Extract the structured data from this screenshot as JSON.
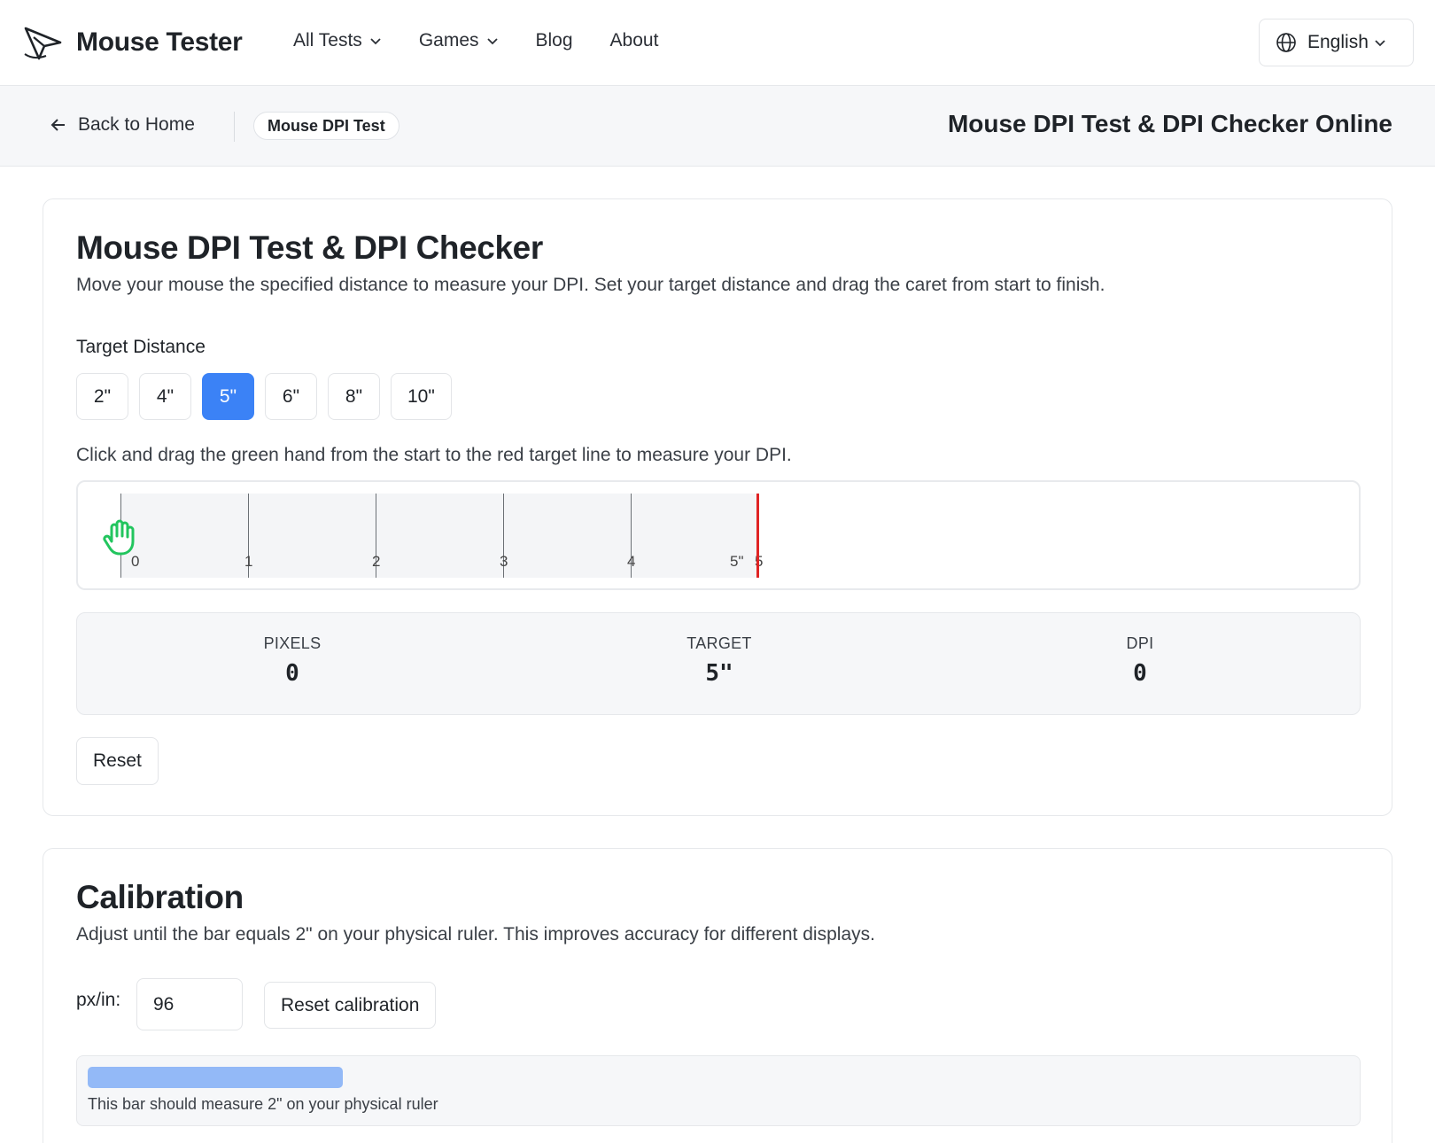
{
  "header": {
    "brand": "Mouse Tester",
    "nav": [
      {
        "label": "All Tests"
      },
      {
        "label": "Games"
      },
      {
        "label": "Blog"
      },
      {
        "label": "About"
      }
    ],
    "language": "English"
  },
  "subbar": {
    "back_label": "Back to Home",
    "crumb": "Mouse DPI Test",
    "page_title": "Mouse DPI Test & DPI Checker Online"
  },
  "dpi_card": {
    "title": "Mouse DPI Test & DPI Checker",
    "description": "Move your mouse the specified distance to measure your DPI. Set your target distance and drag the caret from start to finish.",
    "target_distance_label": "Target Distance",
    "distances": [
      "2\"",
      "4\"",
      "5\"",
      "6\"",
      "8\"",
      "10\""
    ],
    "selected_distance": "5\"",
    "instruction": "Click and drag the green hand from the start to the red target line to measure your DPI.",
    "ruler": {
      "ticks": [
        "0",
        "1",
        "2",
        "3",
        "4"
      ],
      "target_label": "5\"",
      "target_tick": "5"
    },
    "stats": [
      {
        "label": "PIXELS",
        "value": "0"
      },
      {
        "label": "TARGET",
        "value": "5\""
      },
      {
        "label": "DPI",
        "value": "0"
      }
    ],
    "reset_label": "Reset"
  },
  "calibration_card": {
    "title": "Calibration",
    "description": "Adjust until the bar equals 2\" on your physical ruler. This improves accuracy for different displays.",
    "pxin_label": "px/in:",
    "pxin_value": "96",
    "reset_label": "Reset calibration",
    "bar_note": "This bar should measure 2\" on your physical ruler"
  },
  "colors": {
    "accent": "#3b82f6",
    "target_line": "#e02424",
    "hand": "#22c55e",
    "calibration_bar": "#93b9f7"
  }
}
